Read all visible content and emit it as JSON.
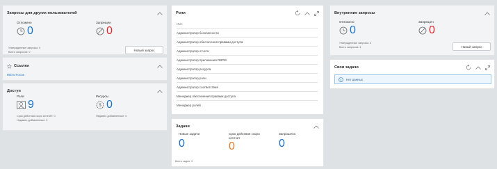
{
  "colors": {
    "accent": "#1a73c9",
    "danger": "#e0282e",
    "warning": "#e07a2a"
  },
  "requests_card": {
    "title": "Запросы для других пользователей",
    "postponed_label": "Отложено",
    "postponed_value": "0",
    "denied_label": "Запрещен",
    "denied_value": "0",
    "approved_text": "Утвержденные запросы: 0",
    "total_text": "Всего запросов: 0",
    "new_request_btn": "Новый запрос"
  },
  "links_card": {
    "title": "Ссылки",
    "link": "Micro Focus"
  },
  "access_card": {
    "title": "Доступ",
    "roles_label": "Роли",
    "roles_value": "9",
    "resources_label": "Ресурсы",
    "resources_value": "0",
    "expiring_text": "Срок действия скоро истечет: 0",
    "recent_roles_text": "Недавно добавленные: 0",
    "recent_resources_text": "Недавно добавленные: 0"
  },
  "roles_card": {
    "title": "Роли",
    "column": "Имя",
    "items": [
      "Администратор безопасности",
      "Администратор обеспечения правами доступа",
      "Администратор отчета",
      "Администратор приложения RBPM",
      "Администратор ресурса",
      "Администратор роли",
      "Администратор соответствия",
      "Менеджер обеспечения правами доступа",
      "Менеджер ролей"
    ]
  },
  "tasks_card": {
    "title": "Задачи",
    "new_label": "Новые задачи",
    "new_value": "0",
    "expiring_label": "Срок действия скоро истечет",
    "expiring_value": "0",
    "requested_label": "Запрошено",
    "requested_value": "0",
    "total_text": "Всего задач: 0"
  },
  "internal_card": {
    "title": "Внутренние запросы",
    "postponed_label": "Отложено",
    "postponed_value": "0",
    "denied_label": "Запрещен",
    "denied_value": "0",
    "approved_text": "Утвержденные запросы: 4",
    "total_text": "Всего запросов: 4",
    "new_request_btn": "Новый запрос"
  },
  "own_tasks_card": {
    "title": "Свои задачи",
    "empty_text": "Нет данных"
  },
  "icons": {
    "collapse": "chevron-up-icon",
    "refresh": "refresh-icon",
    "expand": "expand-icon",
    "star": "star-icon",
    "clock": "clock-icon",
    "denied": "denied-icon",
    "roles": "role-icon",
    "resources": "resource-icon",
    "info": "info-icon"
  }
}
